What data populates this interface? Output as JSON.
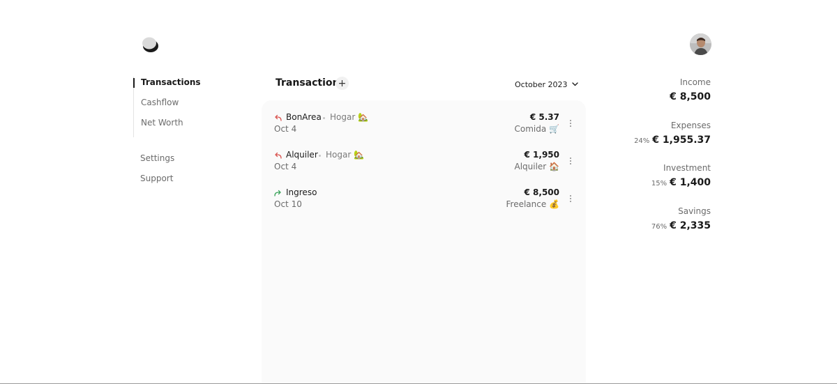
{
  "sidebar": {
    "primary": [
      {
        "label": "Transactions",
        "active": true
      },
      {
        "label": "Cashflow",
        "active": false
      },
      {
        "label": "Net Worth",
        "active": false
      }
    ],
    "secondary": [
      {
        "label": "Settings"
      },
      {
        "label": "Support"
      }
    ]
  },
  "header": {
    "title": "Transactions",
    "add_label": "+",
    "month": "October 2023"
  },
  "transactions": [
    {
      "direction": "expense",
      "name": "BonArea",
      "category": "Hogar 🏡",
      "date": "Oct 4",
      "amount": "€ 5.37",
      "subcategory": "Comida 🛒"
    },
    {
      "direction": "expense",
      "name": "Alquiler",
      "category": "Hogar 🏡",
      "date": "Oct 4",
      "amount": "€ 1,950",
      "subcategory": "Alquiler 🏠"
    },
    {
      "direction": "income",
      "name": "Ingreso",
      "category": "",
      "date": "Oct 10",
      "amount": "€ 8,500",
      "subcategory": "Freelance 💰"
    }
  ],
  "summary": {
    "income": {
      "label": "Income",
      "percent": "",
      "value": "€ 8,500"
    },
    "expenses": {
      "label": "Expenses",
      "percent": "24%",
      "value": "€ 1,955.37"
    },
    "investment": {
      "label": "Investment",
      "percent": "15%",
      "value": "€ 1,400"
    },
    "savings": {
      "label": "Savings",
      "percent": "76%",
      "value": "€ 2,335"
    }
  },
  "colors": {
    "expense_arrow": "#d9534f",
    "income_arrow": "#3aa35a",
    "panel_bg": "#fafafa",
    "text_primary": "#1a1a1a",
    "text_muted": "#6b6b6b"
  },
  "icons": {
    "logo": "app-logo-icon",
    "expense": "arrow-return-left-icon",
    "income": "arrow-forward-right-icon",
    "more": "more-vertical-icon",
    "dropdown": "chevron-down-icon"
  }
}
